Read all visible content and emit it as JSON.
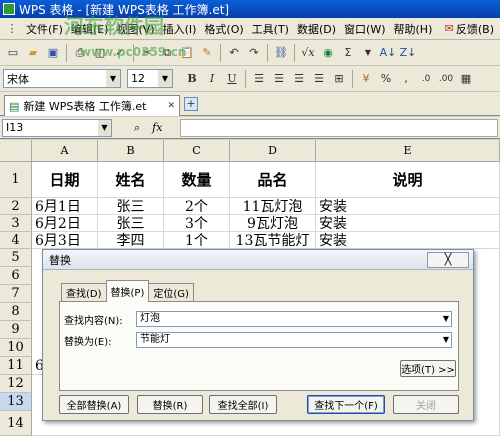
{
  "window": {
    "title": "WPS 表格 - [新建 WPS表格 工作簿.et]"
  },
  "menu": [
    "文件(F)",
    "编辑(E)",
    "视图(V)",
    "插入(I)",
    "格式(O)",
    "工具(T)",
    "数据(D)",
    "窗口(W)",
    "帮助(H)"
  ],
  "menu_feedback": "反馈(B)",
  "format_toolbar": {
    "font": "宋体",
    "size": "12",
    "bold": "B",
    "italic": "I",
    "underline": "U"
  },
  "doc_tab": {
    "label": "新建 WPS表格 工作簿.et"
  },
  "formula_bar": {
    "cell_ref": "I13",
    "fx": "fx"
  },
  "columns": [
    "A",
    "B",
    "C",
    "D",
    "E"
  ],
  "rows": [
    "1",
    "2",
    "3",
    "4",
    "5",
    "6",
    "7",
    "8",
    "9",
    "10",
    "11",
    "12",
    "13",
    "14"
  ],
  "table": {
    "headers": [
      "日期",
      "姓名",
      "数量",
      "品名",
      "说明"
    ],
    "data": [
      [
        "6月1日",
        "张三",
        "2个",
        "11瓦灯泡",
        "安装"
      ],
      [
        "6月2日",
        "张三",
        "3个",
        "9瓦灯泡",
        "安装"
      ],
      [
        "6月3日",
        "李四",
        "1个",
        "13瓦节能灯",
        "安装"
      ]
    ],
    "row11_a": "6"
  },
  "dialog": {
    "title": "替换",
    "close": "╳",
    "tabs": [
      "查找(D)",
      "替换(P)",
      "定位(G)"
    ],
    "find_label": "查找内容(N):",
    "find_value": "灯泡",
    "replace_label": "替换为(E):",
    "replace_value": "节能灯",
    "options": "选项(T) >>",
    "buttons": [
      "全部替换(A)",
      "替换(R)",
      "查找全部(I)",
      "查找下一个(F)",
      "关闭"
    ]
  },
  "watermark": {
    "line1": "河东软件园",
    "line2": "www.pc0359.cn"
  }
}
